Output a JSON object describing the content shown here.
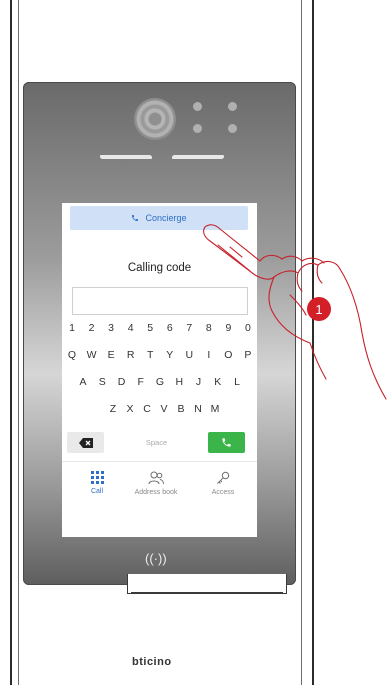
{
  "screen": {
    "concierge_label": "Concierge",
    "calling_code_label": "Calling code",
    "calling_code_value": "",
    "keyboard_rows": [
      [
        "1",
        "2",
        "3",
        "4",
        "5",
        "6",
        "7",
        "8",
        "9",
        "0"
      ],
      [
        "Q",
        "W",
        "E",
        "R",
        "T",
        "Y",
        "U",
        "I",
        "O",
        "P"
      ],
      [
        "A",
        "S",
        "D",
        "F",
        "G",
        "H",
        "J",
        "K",
        "L"
      ],
      [
        "Z",
        "X",
        "C",
        "V",
        "B",
        "N",
        "M"
      ]
    ],
    "space_label": "Space",
    "tabs": [
      {
        "label": "Call",
        "icon": "keypad-icon",
        "active": true
      },
      {
        "label": "Address book",
        "icon": "address-book-icon",
        "active": false
      },
      {
        "label": "Access",
        "icon": "key-icon",
        "active": false
      }
    ]
  },
  "nfc_symbol": "((·))",
  "brand": "bticino",
  "step_badge": "1",
  "colors": {
    "accent_blue": "#2e6fc7",
    "concierge_bg": "#cfe0f7",
    "call_green": "#3bb54a",
    "badge_red": "#d31f28",
    "hand_outline": "#c8202a"
  }
}
